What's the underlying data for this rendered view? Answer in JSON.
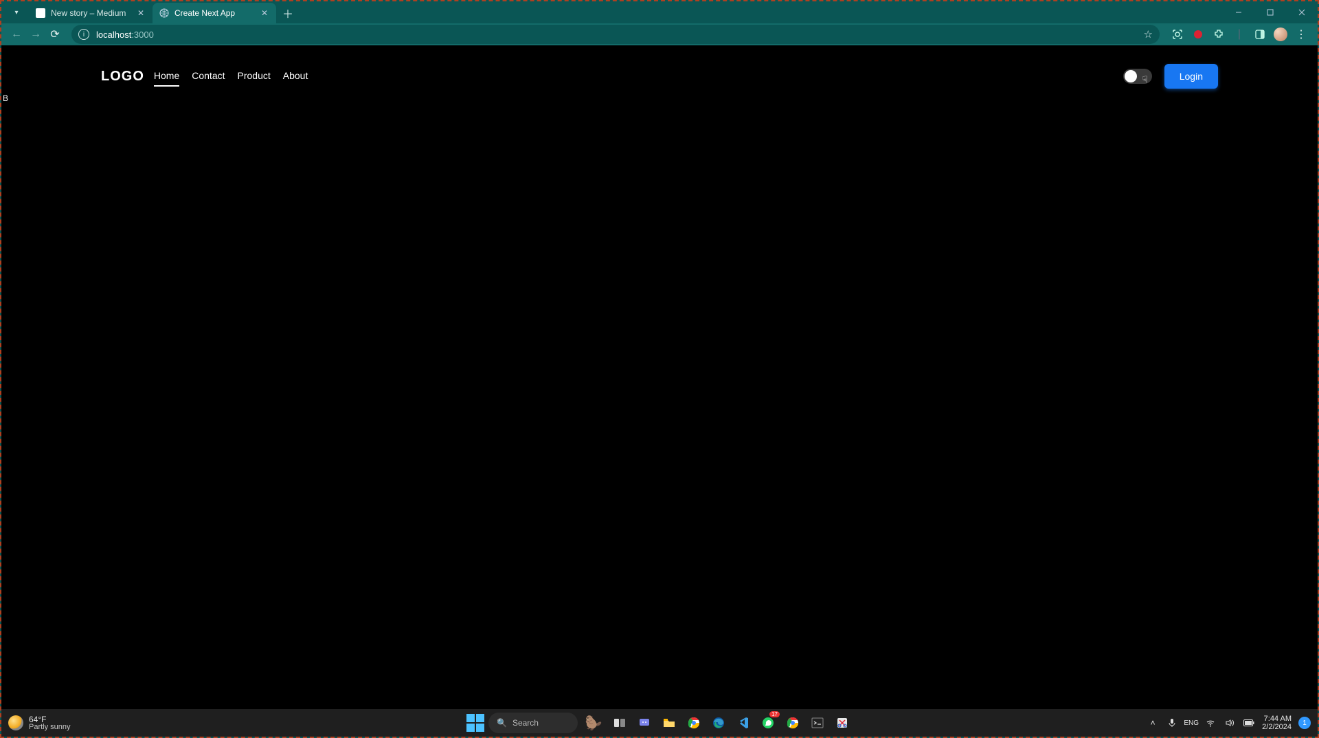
{
  "browser": {
    "tabs": [
      {
        "title": "New story – Medium",
        "active": false,
        "favicon": "medium-icon"
      },
      {
        "title": "Create Next App",
        "active": true,
        "favicon": "globe-icon"
      }
    ],
    "url_host": "localhost",
    "url_port": ":3000",
    "nav": {
      "back_enabled": false,
      "forward_enabled": false
    }
  },
  "page": {
    "logo": "LOGO",
    "nav_items": [
      {
        "label": "Home",
        "active": true
      },
      {
        "label": "Contact",
        "active": false
      },
      {
        "label": "Product",
        "active": false
      },
      {
        "label": "About",
        "active": false
      }
    ],
    "theme_toggle": {
      "on": false
    },
    "login_label": "Login",
    "stray_char": "B"
  },
  "taskbar": {
    "weather": {
      "temp": "64°F",
      "condition": "Partly sunny"
    },
    "search_placeholder": "Search",
    "apps": [
      "task-view-icon",
      "chat-icon",
      "file-explorer-icon",
      "chrome-icon",
      "edge-icon",
      "vscode-icon",
      "whatsapp-icon",
      "chrome-alt-icon",
      "terminal-icon",
      "snip-icon"
    ],
    "clock": {
      "time": "7:44 AM",
      "date": "2/2/2024"
    },
    "notif_count": "1"
  }
}
